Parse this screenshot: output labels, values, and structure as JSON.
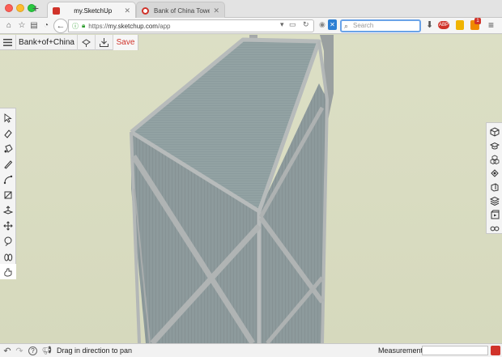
{
  "browser": {
    "tabs": [
      {
        "title": "my.SketchUp",
        "active": true
      },
      {
        "title": "Bank of China Tower, Hong…",
        "active": false
      }
    ],
    "url": {
      "scheme": "https://",
      "host": "my.sketchup.com",
      "path": "/app"
    },
    "search": {
      "placeholder": "Search"
    },
    "notification_count": "1"
  },
  "app": {
    "model_title": "Bank+of+China",
    "save_label": "Save",
    "accent_color": "#d0332a",
    "left_tools": [
      {
        "name": "select-icon"
      },
      {
        "name": "eraser-icon"
      },
      {
        "name": "paint-bucket-icon"
      },
      {
        "name": "pencil-line-icon"
      },
      {
        "name": "arc-icon"
      },
      {
        "name": "rectangle-icon"
      },
      {
        "name": "push-pull-icon"
      },
      {
        "name": "move-icon"
      },
      {
        "name": "tape-measure-icon"
      },
      {
        "name": "orbit-icon"
      },
      {
        "name": "pan-hand-icon",
        "active": true
      }
    ],
    "right_tools": [
      {
        "name": "entity-info-icon"
      },
      {
        "name": "instructor-icon"
      },
      {
        "name": "components-icon"
      },
      {
        "name": "materials-icon"
      },
      {
        "name": "styles-icon"
      },
      {
        "name": "layers-icon"
      },
      {
        "name": "scenes-icon"
      },
      {
        "name": "display-glasses-icon"
      }
    ],
    "status": {
      "message": "Drag in direction to pan",
      "measurements_label": "Measurements",
      "measurements_value": ""
    }
  }
}
